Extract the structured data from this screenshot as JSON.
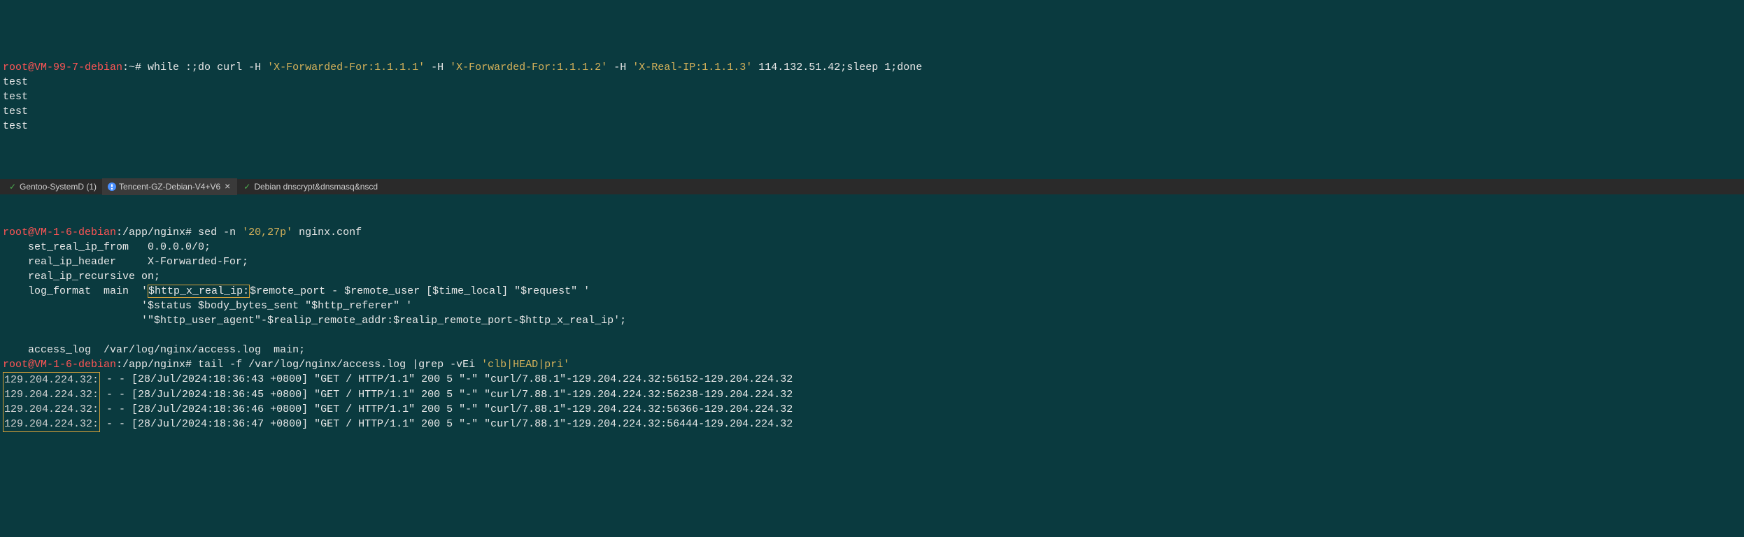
{
  "top": {
    "prompt_user": "root@VM-99-7-debian",
    "prompt_path": ":~#",
    "cmd_part1": " while :;do curl -H ",
    "str1": "'X-Forwarded-For:1.1.1.1'",
    "cmd_part2": " -H ",
    "str2": "'X-Forwarded-For:1.1.1.2'",
    "cmd_part3": " -H ",
    "str3": "'X-Real-IP:1.1.1.3'",
    "cmd_part4": " 114.132.51.42;sleep 1;done",
    "outputs": [
      "test",
      "test",
      "test",
      "test"
    ]
  },
  "tabs": [
    {
      "icon": "check",
      "label": "Gentoo-SystemD (1)"
    },
    {
      "icon": "warn",
      "label": "Tencent-GZ-Debian-V4+V6",
      "active": true,
      "closable": true
    },
    {
      "icon": "check",
      "label": "Debian dnscrypt&dnsmasq&nscd"
    }
  ],
  "bottom": {
    "prompt_user": "root@VM-1-6-debian",
    "prompt_path": ":/app/nginx#",
    "cmd1_part1": " sed -n ",
    "cmd1_str": "'20,27p'",
    "cmd1_part2": " nginx.conf",
    "conf_lines": {
      "l1": "    set_real_ip_from   0.0.0.0/0;",
      "l2": "    real_ip_header     X-Forwarded-For;",
      "l3": "    real_ip_recursive on;",
      "l4_pre": "    log_format  main  '",
      "l4_box": "$http_x_real_ip:",
      "l4_post": "$remote_port - $remote_user [$time_local] \"$request\" '",
      "l5": "                      '$status $body_bytes_sent \"$http_referer\" '",
      "l6": "                      '\"$http_user_agent\"-$realip_remote_addr:$realip_remote_port-$http_x_real_ip';",
      "l7": "",
      "l8": "    access_log  /var/log/nginx/access.log  main;"
    },
    "cmd2_part1": " tail -f /var/log/nginx/access.log |grep -vEi ",
    "cmd2_str": "'clb|HEAD|pri'",
    "log_entries": [
      {
        "ip": "129.204.224.32:",
        "rest": " - - [28/Jul/2024:18:36:43 +0800] \"GET / HTTP/1.1\" 200 5 \"-\" \"curl/7.88.1\"-129.204.224.32:56152-129.204.224.32"
      },
      {
        "ip": "129.204.224.32:",
        "rest": " - - [28/Jul/2024:18:36:45 +0800] \"GET / HTTP/1.1\" 200 5 \"-\" \"curl/7.88.1\"-129.204.224.32:56238-129.204.224.32"
      },
      {
        "ip": "129.204.224.32:",
        "rest": " - - [28/Jul/2024:18:36:46 +0800] \"GET / HTTP/1.1\" 200 5 \"-\" \"curl/7.88.1\"-129.204.224.32:56366-129.204.224.32"
      },
      {
        "ip": "129.204.224.32:",
        "rest": " - - [28/Jul/2024:18:36:47 +0800] \"GET / HTTP/1.1\" 200 5 \"-\" \"curl/7.88.1\"-129.204.224.32:56444-129.204.224.32"
      }
    ]
  }
}
